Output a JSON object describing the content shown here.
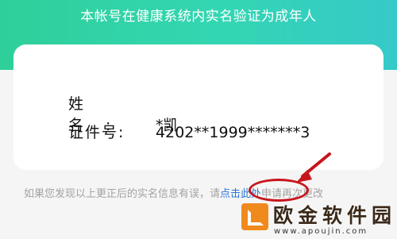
{
  "header": {
    "title": "本帐号在健康系统内实名验证为成年人"
  },
  "card": {
    "name_label": "姓名:",
    "name_value": "*凯",
    "id_label": "证件号:",
    "id_value": "4202**1999*******3"
  },
  "notice": {
    "text_before": "如果您发现以上更正后的实名信息有误，请",
    "link": "点击此处",
    "text_after": "申请再次更改"
  },
  "watermark": {
    "title": "欧金软件园",
    "url": "www.apoujin.com"
  },
  "colors": {
    "header_green": "#33d6b2",
    "link_blue": "#2b77d8",
    "annotation_red": "#c8151c"
  }
}
